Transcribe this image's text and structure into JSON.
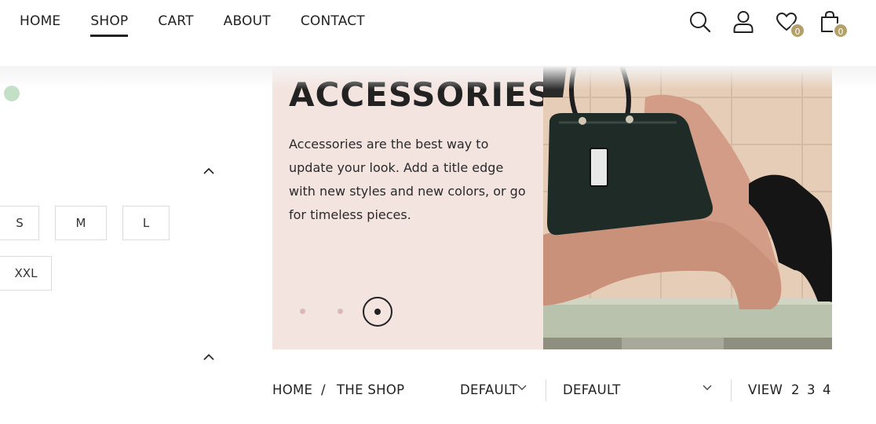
{
  "nav": {
    "items": [
      {
        "label": "HOME",
        "active": false
      },
      {
        "label": "SHOP",
        "active": true
      },
      {
        "label": "CART",
        "active": false
      },
      {
        "label": "ABOUT",
        "active": false
      },
      {
        "label": "CONTACT",
        "active": false
      }
    ]
  },
  "header_icons": {
    "search": "search-icon",
    "account": "user-icon",
    "wishlist": {
      "icon": "heart-icon",
      "count": "0"
    },
    "cart": {
      "icon": "shopping-bag-icon",
      "count": "0"
    }
  },
  "sidebar": {
    "sizes": [
      "S",
      "M",
      "L",
      "XXL"
    ],
    "color_swatch": "#c3dfc6"
  },
  "banner": {
    "title": "ACCESSORIES",
    "text": "Accessories are the best way to update your look. Add a title edge with new styles and new colors, or go for timeless pieces.",
    "slides": 3,
    "active_slide": 3,
    "image": "woman-with-black-handbag-photo"
  },
  "toolbar": {
    "breadcrumb": [
      "HOME",
      "/",
      "THE SHOP"
    ],
    "sort_1": "DEFAULT",
    "sort_2": "DEFAULT",
    "view_label": "VIEW",
    "view_options": [
      "2",
      "3",
      "4"
    ]
  },
  "colors": {
    "accent": "#b4a06a",
    "banner_bg": "#f4e4df",
    "text": "#222222"
  }
}
